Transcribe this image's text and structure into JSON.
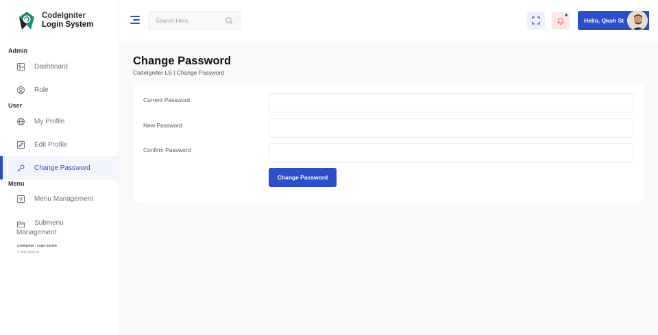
{
  "brand": {
    "line1": "CodeIgniter",
    "line2": "Login System"
  },
  "sidebar": {
    "sections": [
      {
        "title": "Admin"
      },
      {
        "title": "User"
      },
      {
        "title": "Menu"
      }
    ],
    "items": [
      {
        "label": "Dashboard",
        "icon": "dashboard-icon"
      },
      {
        "label": "Role",
        "icon": "role-icon"
      },
      {
        "label": "My Profile",
        "icon": "globe-icon"
      },
      {
        "label": "Edit Profile",
        "icon": "edit-icon"
      },
      {
        "label": "Change Password",
        "icon": "key-icon",
        "active": true
      },
      {
        "label": "Menu Management",
        "icon": "menu-icon"
      },
      {
        "label_line1": "Submenu",
        "label_line2": "Management",
        "icon": "folder-icon"
      }
    ],
    "footer": {
      "title": "CodeIgniter - Login System",
      "copyright": "© 2020 Qkoh St"
    }
  },
  "topbar": {
    "search_placeholder": "Search Here",
    "user_greeting": "Hello, Qkoh St"
  },
  "page": {
    "title": "Change Password",
    "breadcrumb": "CodeIgniter LS | Change Password"
  },
  "form": {
    "current_label": "Current Password",
    "new_label": "New Password",
    "confirm_label": "Confirm Password",
    "current_value": "",
    "new_value": "",
    "confirm_value": "",
    "submit_label": "Change Password"
  },
  "colors": {
    "primary": "#2c4ec9",
    "bell_bg": "#fde7e4",
    "fullscreen_bg": "#eef1fb",
    "page_bg": "#f9f9f9"
  }
}
